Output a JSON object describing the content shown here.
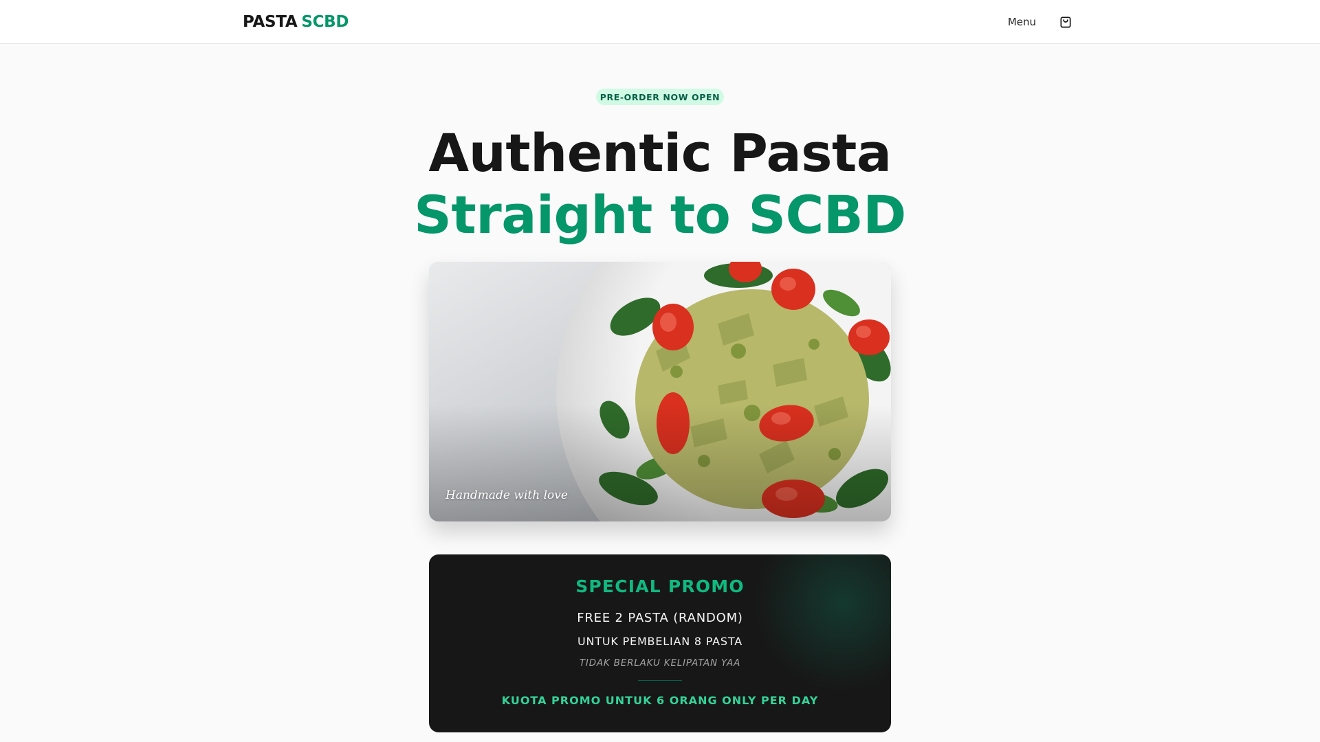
{
  "header": {
    "logo_main": "PASTA",
    "logo_accent": "SCBD",
    "menu_label": "Menu",
    "cart_icon": "shopping-bag-icon"
  },
  "hero": {
    "badge": "PRE-ORDER NOW OPEN",
    "headline_line1": "Authentic Pasta",
    "headline_line2": "Straight to SCBD",
    "image_caption": "Handmade with love"
  },
  "promo": {
    "title": "SPECIAL PROMO",
    "line1": "FREE 2 PASTA (RANDOM)",
    "line2": "UNTUK PEMBELIAN 8 PASTA",
    "note": "TIDAK BERLAKU KELIPATAN YAA",
    "quota": "KUOTA PROMO UNTUK 6 ORANG ONLY PER DAY"
  },
  "colors": {
    "accent": "#059669",
    "accent_light": "#34d399",
    "badge_bg": "#d1fae5",
    "dark_card": "#171717"
  }
}
